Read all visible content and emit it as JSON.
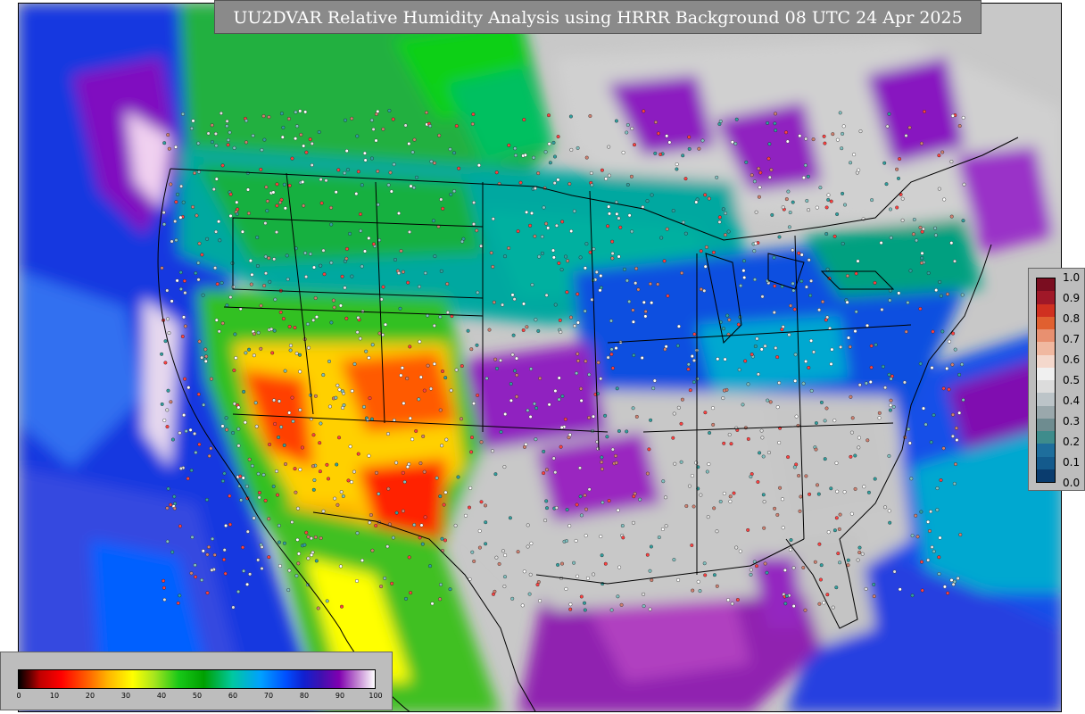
{
  "title": "UU2DVAR Relative Humidity Analysis using HRRR Background 08 UTC 24 Apr 2025",
  "rh_colorbar": {
    "ticks": [
      "0",
      "10",
      "20",
      "30",
      "40",
      "50",
      "60",
      "70",
      "80",
      "90",
      "100"
    ]
  },
  "increment_colorbar": {
    "ticks": [
      "1.0",
      "0.9",
      "0.8",
      "0.7",
      "0.6",
      "0.5",
      "0.4",
      "0.3",
      "0.2",
      "0.1",
      "0.0"
    ],
    "colors": [
      "#7a0d20",
      "#a01828",
      "#d03020",
      "#e06030",
      "#e89070",
      "#f0b8a0",
      "#f4d8cc",
      "#f0f0f0",
      "#dcdcdc",
      "#bcc4c8",
      "#9aa8ac",
      "#6e8c90",
      "#3e8c8c",
      "#1e6e9c",
      "#145a8c",
      "#0a3c6e"
    ]
  },
  "colors": {
    "land_gray": "#c8c8c8",
    "ocean_blue": "#1030d0",
    "dry_red": "#ff2000",
    "moist_green": "#18c818"
  }
}
